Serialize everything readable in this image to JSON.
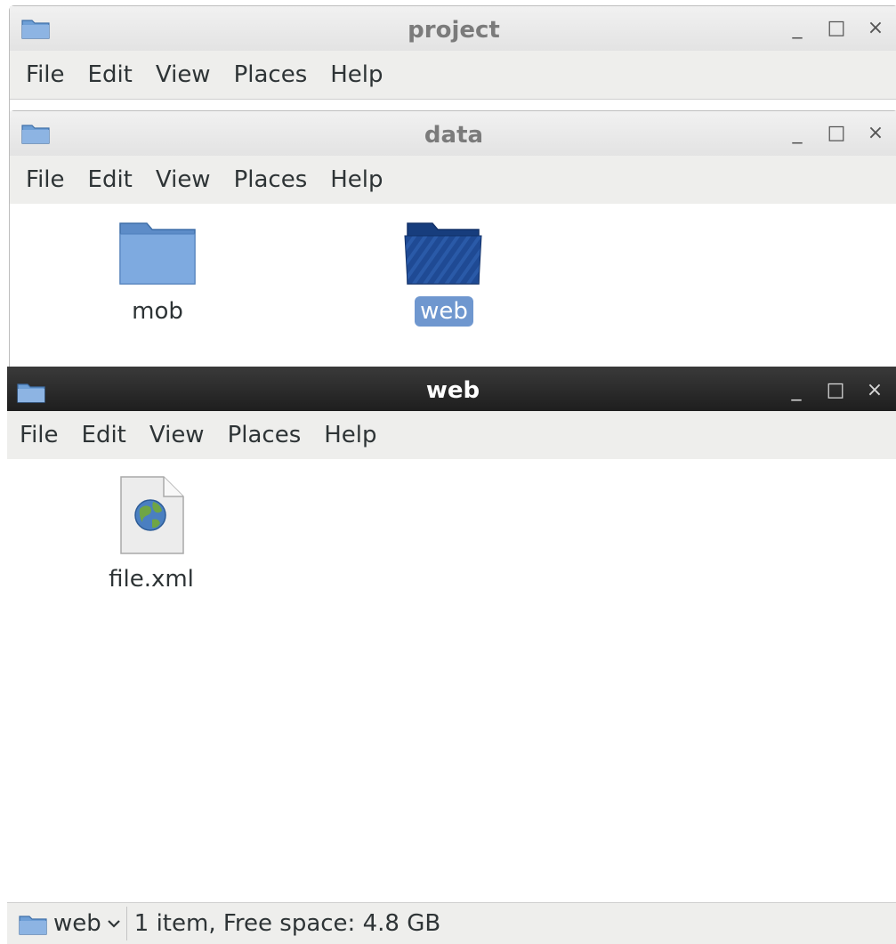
{
  "windows": {
    "project": {
      "title": "project",
      "menu": [
        "File",
        "Edit",
        "View",
        "Places",
        "Help"
      ]
    },
    "data": {
      "title": "data",
      "menu": [
        "File",
        "Edit",
        "View",
        "Places",
        "Help"
      ],
      "items": [
        {
          "label": "mob",
          "icon": "folder-icon",
          "selected": false
        },
        {
          "label": "web",
          "icon": "folder-icon",
          "selected": true
        }
      ]
    },
    "web": {
      "title": "web",
      "menu": [
        "File",
        "Edit",
        "View",
        "Places",
        "Help"
      ],
      "items": [
        {
          "label": "file.xml",
          "icon": "xml-file-icon"
        }
      ],
      "statusbar": {
        "location": "web",
        "status": "1 item, Free space: 4.8 GB"
      }
    }
  },
  "window_controls": {
    "minimize": "_",
    "maximize": "□",
    "close": "×"
  },
  "colors": {
    "folder": "#6e9fd6",
    "folder_selected": "#1f4a94",
    "selection": "#6f97cf",
    "active_titlebar": "#262626"
  }
}
